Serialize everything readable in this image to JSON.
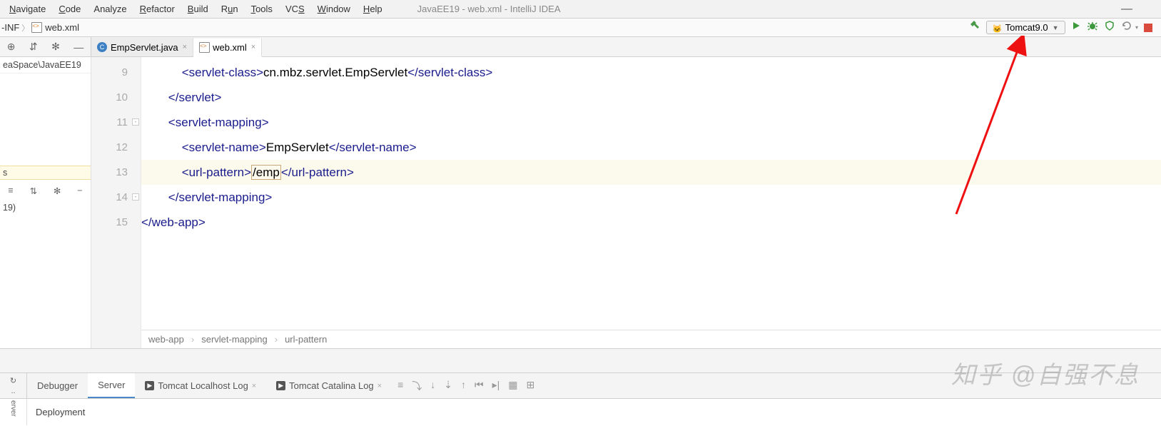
{
  "menu": [
    "Navigate",
    "Code",
    "Analyze",
    "Refactor",
    "Build",
    "Run",
    "Tools",
    "VCS",
    "Window",
    "Help"
  ],
  "menu_u": [
    "N",
    "C",
    "",
    "R",
    "B",
    "R",
    "T",
    "",
    "W",
    "H"
  ],
  "window_title": "JavaEE19 - web.xml - IntelliJ IDEA",
  "breadcrumb": {
    "a": "-INF",
    "b": "web.xml"
  },
  "run_config": {
    "label": "Tomcat9.0"
  },
  "tabs": [
    {
      "label": "EmpServlet.java",
      "active": false,
      "kind": "java"
    },
    {
      "label": "web.xml",
      "active": true,
      "kind": "xml"
    }
  ],
  "sidebar": {
    "path": "eaSpace\\JavaEE19",
    "sel": "s",
    "node": "19)"
  },
  "code": {
    "lines": [
      {
        "n": 9,
        "indent": 3,
        "open": "servlet-class",
        "text": "cn.mbz.servlet.EmpServlet",
        "close": "servlet-class"
      },
      {
        "n": 10,
        "indent": 2,
        "closeOnly": "servlet"
      },
      {
        "n": 11,
        "indent": 2,
        "openOnly": "servlet-mapping",
        "fold": true
      },
      {
        "n": 12,
        "indent": 3,
        "open": "servlet-name",
        "text": "EmpServlet",
        "close": "servlet-name"
      },
      {
        "n": 13,
        "indent": 3,
        "open": "url-pattern",
        "text": "/emp",
        "close": "url-pattern",
        "hl": true,
        "box": true
      },
      {
        "n": 14,
        "indent": 2,
        "closeOnly": "servlet-mapping",
        "foldEnd": true
      },
      {
        "n": 15,
        "indent": 0,
        "closeOnly": "web-app"
      }
    ]
  },
  "editor_crumbs": [
    "web-app",
    "servlet-mapping",
    "url-pattern"
  ],
  "bottom_tabs": {
    "items": [
      "Debugger",
      "Server",
      "Tomcat Localhost Log",
      "Tomcat Catalina Log"
    ],
    "active": 1
  },
  "deployment_label": "Deployment",
  "server_side": "erver",
  "watermark": "知乎 @自强不息"
}
